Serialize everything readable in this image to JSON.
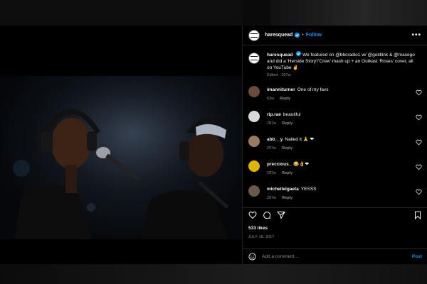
{
  "post": {
    "username": "haresquead",
    "follow_label": "Follow",
    "separator": "•",
    "caption_text": "We featured on @bbcradio1 w/ @goldlink & @masego and did a 'Herside Story'/'Crew' mash up + an Outkast 'Roses' cover, all on YouTube ✌",
    "caption_meta": "Edited · 297w",
    "likes": "533 likes",
    "date": "JULY 18, 2017"
  },
  "comments": [
    {
      "username": "imanniturner",
      "text": "One of my favs",
      "time": "63w",
      "reply": "Reply",
      "avatar_color": "#6b4a3a"
    },
    {
      "username": "rip.rae",
      "text": "beautiful",
      "time": "287w",
      "reply": "Reply",
      "avatar_color": "#d9d9d9"
    },
    {
      "username": "abb__y",
      "text": "Nailed it 🙏 ❤",
      "time": "297w",
      "reply": "Reply",
      "avatar_color": "#9a7a60"
    },
    {
      "username": "preccious_",
      "text": "😂👌❤",
      "time": "297w",
      "reply": "Reply",
      "avatar_color": "#e0b400"
    },
    {
      "username": "michellelgaeta",
      "text": "YESSS",
      "time": "297w",
      "reply": "Reply",
      "avatar_color": "#6a5a4a"
    }
  ],
  "composer": {
    "placeholder": "Add a comment…",
    "post_label": "Post"
  },
  "icons": {
    "more": "more-options-icon",
    "like": "heart-icon",
    "comment": "comment-icon",
    "share": "share-icon",
    "save": "bookmark-icon",
    "emoji": "emoji-icon"
  },
  "colors": {
    "accent": "#0095f6",
    "background": "#000000",
    "muted": "#8e8e8e"
  }
}
